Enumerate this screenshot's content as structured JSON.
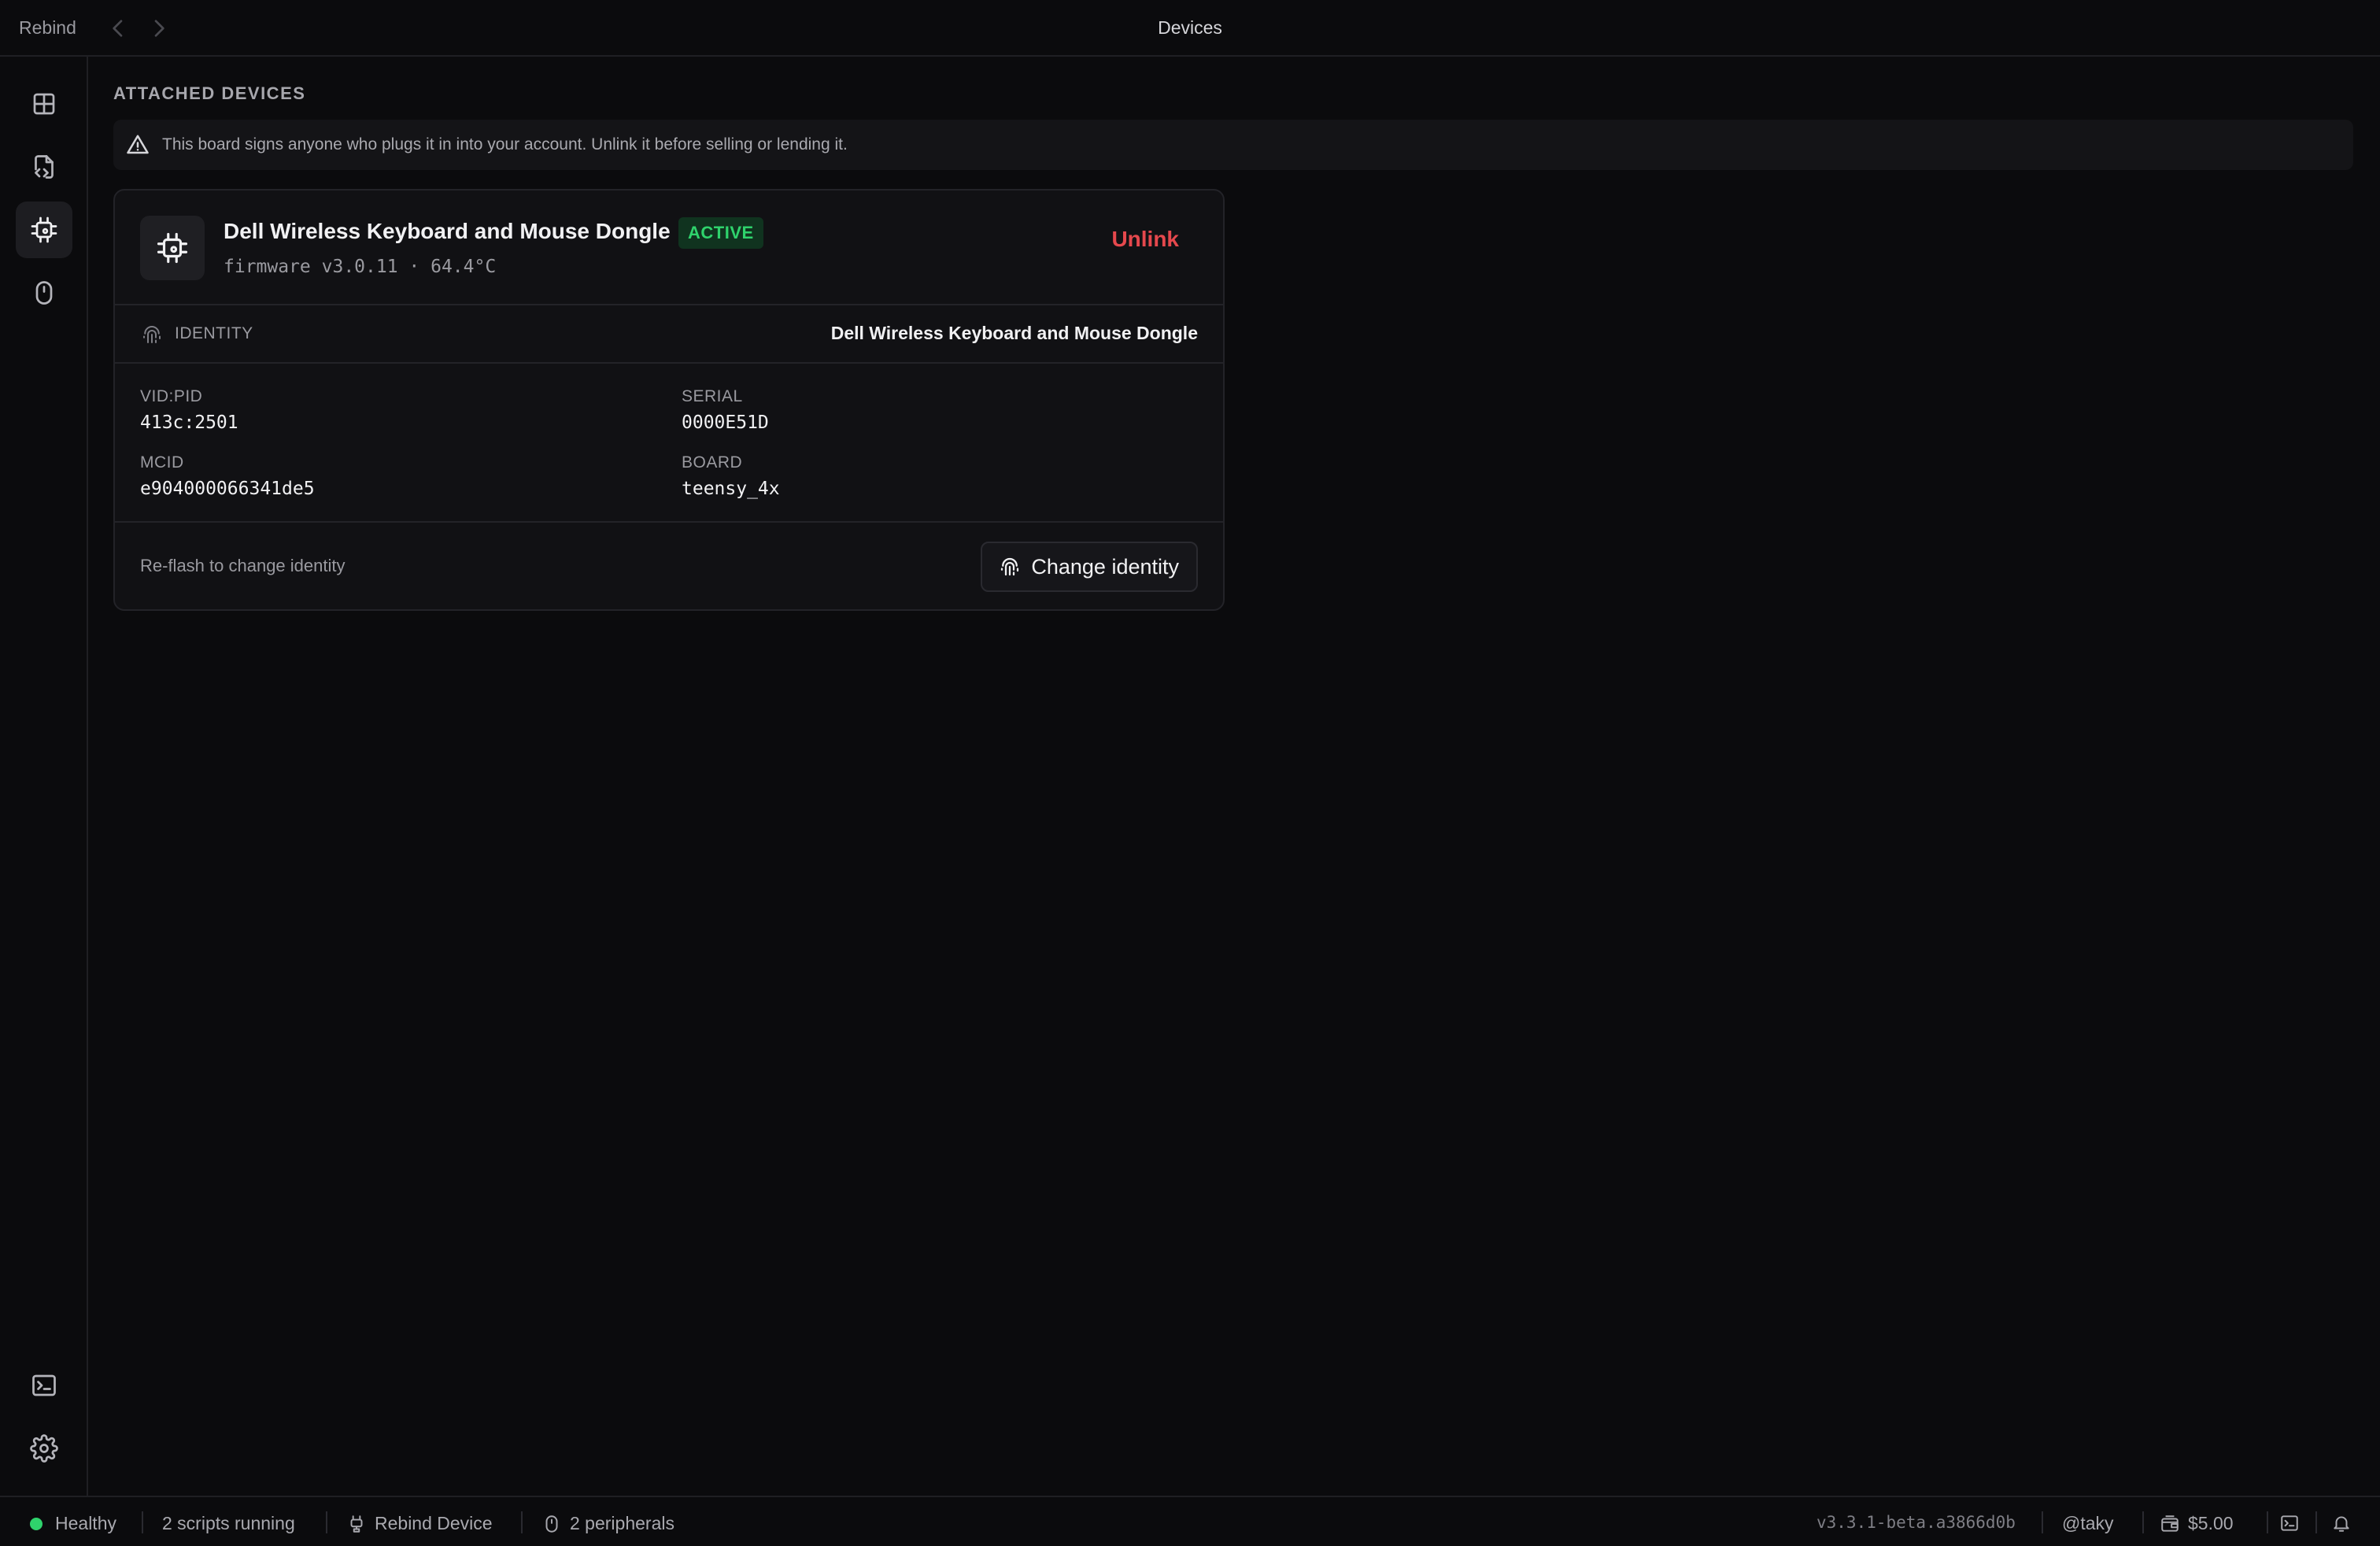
{
  "titlebar": {
    "app_name": "Rebind",
    "window_title": "Devices"
  },
  "sidebar": {
    "items": [
      {
        "icon": "dashboard-grid-icon",
        "active": false
      },
      {
        "icon": "script-file-icon",
        "active": false
      },
      {
        "icon": "chip-icon",
        "active": true
      },
      {
        "icon": "mouse-icon",
        "active": false
      }
    ],
    "bottom_items": [
      {
        "icon": "terminal-icon"
      },
      {
        "icon": "gear-icon"
      }
    ]
  },
  "main": {
    "section_title": "ATTACHED DEVICES",
    "warning_text": "This board signs anyone who plugs it in into your account. Unlink it before selling or lending it.",
    "device": {
      "name": "Dell Wireless Keyboard and Mouse Dongle",
      "status": "ACTIVE",
      "firmware": "firmware v3.0.11 · 64.4°C",
      "unlink_label": "Unlink",
      "identity_label": "IDENTITY",
      "identity_value": "Dell Wireless Keyboard and Mouse Dongle",
      "fields": [
        {
          "key": "VID:PID",
          "value": "413c:2501"
        },
        {
          "key": "SERIAL",
          "value": "0000E51D"
        },
        {
          "key": "MCID",
          "value": "e904000066341de5"
        },
        {
          "key": "BOARD",
          "value": "teensy_4x"
        }
      ],
      "reflash_text": "Re-flash to change identity",
      "change_identity_label": "Change identity"
    }
  },
  "statusbar": {
    "health": "Healthy",
    "scripts": "2 scripts running",
    "device": "Rebind Device",
    "peripherals": "2 peripherals",
    "version": "v3.3.1-beta.a3866d0b",
    "user": "@taky",
    "balance": "$5.00"
  },
  "colors": {
    "accent_green": "#2fd36c",
    "danger_red": "#e5484d",
    "background": "#0b0b0d"
  }
}
